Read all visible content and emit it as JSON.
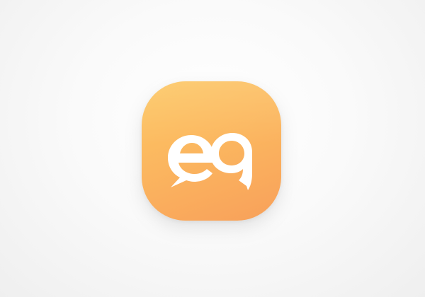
{
  "app": {
    "icon_name": "chat-bubbles-icon",
    "colors": {
      "background": "#f4f4f4",
      "gradient_start": "#fdc864",
      "gradient_end": "#f8a05a",
      "glyph": "#ffffff"
    }
  }
}
